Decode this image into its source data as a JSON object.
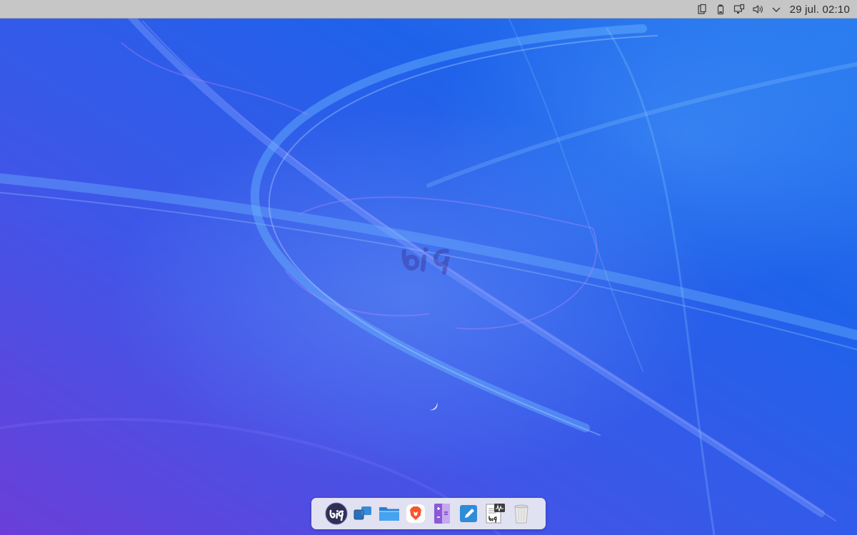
{
  "top_panel": {
    "clock": "29 jul. 02:10",
    "tray_icons": [
      "clipboard-icon",
      "battery-icon",
      "display-icon",
      "volume-icon",
      "chevron-down-icon"
    ]
  },
  "desktop": {
    "wallpaper_logo_text": "big",
    "colors": {
      "base": "#1f57e6",
      "purple": "#6a3fd8",
      "light": "#3a8cf5"
    }
  },
  "dock": {
    "items": [
      {
        "icon": "big-menu-icon"
      },
      {
        "icon": "window-switcher-icon"
      },
      {
        "icon": "folder-icon"
      },
      {
        "icon": "brave-browser-icon"
      },
      {
        "icon": "calculator-icon"
      },
      {
        "icon": "text-editor-icon"
      },
      {
        "icon": "document-viewer-icon"
      },
      {
        "icon": "trash-icon"
      }
    ]
  }
}
